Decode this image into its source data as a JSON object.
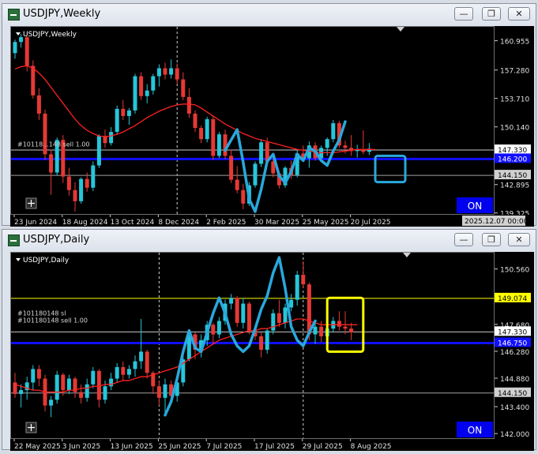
{
  "windows": [
    {
      "title": "USDJPY,Weekly",
      "chart_label": "USDJPY,Weekly",
      "order_label_a": "#10118...148 sell 1.00",
      "order_label_b": "",
      "on_label": "ON",
      "end_date_label": "2025.12.07 00:00",
      "buttons": [
        "minimize",
        "restore",
        "close"
      ]
    },
    {
      "title": "USDJPY,Daily",
      "chart_label": "USDJPY,Daily",
      "order_label_a": "#101180148 sl",
      "order_label_b": "#101180148 sell 1.00",
      "on_label": "ON",
      "end_date_label": "",
      "buttons": [
        "minimize",
        "restore",
        "close"
      ]
    }
  ],
  "chart_data": [
    {
      "type": "candlestick",
      "title": "USDJPY,Weekly",
      "ylim": [
        139.3,
        162.8
      ],
      "yticks": [
        160.955,
        157.28,
        153.71,
        150.14,
        146.57,
        144.15,
        142.895,
        139.325
      ],
      "y_tick_labels": [
        "160.955",
        "157.280",
        "153.710",
        "150.140",
        "",
        "144.150",
        "142.895",
        "139.325"
      ],
      "x_labels": [
        "23 Jun 2024",
        "18 Aug 2024",
        "13 Oct 2024",
        "8 Dec 2024",
        "2 Feb 2025",
        "30 Mar 2025",
        "25 May 2025",
        "20 Jul 2025"
      ],
      "x_label_index": [
        0,
        8,
        16,
        24,
        32,
        40,
        48,
        56
      ],
      "period_separators": [
        27
      ],
      "ma": [
        157.5,
        157.8,
        157.9,
        157.6,
        157.0,
        156.2,
        155.2,
        154.2,
        153.2,
        152.2,
        151.2,
        150.4,
        149.8,
        149.4,
        149.1,
        149.0,
        149.1,
        149.3,
        149.6,
        150.0,
        150.4,
        150.9,
        151.4,
        151.8,
        152.2,
        152.5,
        152.8,
        153.0,
        153.1,
        153.1,
        153.0,
        152.6,
        152.1,
        151.6,
        151.1,
        150.6,
        150.2,
        149.8,
        149.4,
        149.1,
        148.8,
        148.6,
        148.4,
        148.2,
        148.0,
        147.8,
        147.6,
        147.4,
        147.3,
        147.2,
        147.1,
        147.0,
        147.0,
        147.0,
        147.1,
        147.2,
        147.3,
        147.4,
        147.4,
        147.4,
        147.4
      ],
      "ohlc": [
        [
          159.5,
          161.2,
          158.8,
          160.9
        ],
        [
          160.9,
          161.9,
          160.2,
          161.5
        ],
        [
          161.5,
          161.7,
          157.2,
          157.9
        ],
        [
          157.9,
          158.6,
          153.8,
          154.2
        ],
        [
          154.2,
          155.1,
          151.1,
          151.9
        ],
        [
          151.9,
          152.4,
          146.1,
          146.8
        ],
        [
          146.8,
          147.4,
          141.7,
          144.5
        ],
        [
          144.5,
          148.9,
          144.1,
          148.6
        ],
        [
          148.6,
          149.2,
          143.2,
          144.0
        ],
        [
          144.0,
          145.1,
          141.6,
          142.3
        ],
        [
          142.3,
          143.3,
          139.6,
          140.9
        ],
        [
          140.9,
          143.9,
          140.6,
          143.7
        ],
        [
          143.7,
          144.5,
          142.1,
          142.6
        ],
        [
          142.6,
          145.9,
          142.2,
          145.4
        ],
        [
          145.4,
          149.3,
          145.1,
          149.1
        ],
        [
          149.1,
          149.9,
          147.6,
          148.2
        ],
        [
          148.2,
          150.2,
          147.9,
          149.6
        ],
        [
          149.6,
          152.9,
          149.3,
          152.5
        ],
        [
          152.5,
          153.6,
          151.1,
          151.6
        ],
        [
          151.6,
          152.6,
          150.5,
          152.3
        ],
        [
          152.3,
          156.9,
          151.9,
          156.6
        ],
        [
          156.6,
          157.1,
          153.6,
          154.1
        ],
        [
          154.1,
          155.6,
          153.2,
          154.8
        ],
        [
          154.8,
          156.9,
          154.3,
          156.6
        ],
        [
          156.6,
          158.1,
          155.3,
          157.6
        ],
        [
          157.6,
          158.3,
          156.2,
          156.8
        ],
        [
          156.8,
          158.7,
          156.3,
          157.6
        ],
        [
          157.6,
          158.2,
          155.6,
          156.2
        ],
        [
          156.2,
          157.1,
          153.6,
          154.0
        ],
        [
          154.0,
          155.1,
          151.4,
          151.9
        ],
        [
          151.9,
          152.3,
          149.6,
          150.1
        ],
        [
          150.1,
          150.4,
          148.2,
          148.7
        ],
        [
          148.7,
          151.5,
          148.3,
          151.2
        ],
        [
          151.2,
          151.7,
          146.1,
          146.6
        ],
        [
          146.6,
          149.6,
          146.3,
          149.3
        ],
        [
          149.3,
          149.9,
          146.2,
          146.6
        ],
        [
          146.6,
          147.4,
          143.2,
          143.6
        ],
        [
          143.6,
          145.3,
          141.9,
          142.3
        ],
        [
          142.3,
          143.1,
          139.9,
          140.6
        ],
        [
          140.6,
          143.3,
          140.3,
          142.9
        ],
        [
          142.9,
          145.9,
          142.6,
          145.6
        ],
        [
          145.6,
          148.7,
          145.2,
          148.3
        ],
        [
          148.3,
          148.9,
          145.6,
          145.9
        ],
        [
          145.9,
          146.6,
          143.9,
          144.4
        ],
        [
          144.4,
          144.7,
          142.5,
          142.9
        ],
        [
          142.9,
          145.3,
          142.6,
          145.1
        ],
        [
          145.1,
          146.0,
          143.7,
          144.2
        ],
        [
          144.2,
          147.3,
          143.9,
          146.9
        ],
        [
          146.9,
          147.9,
          145.9,
          146.3
        ],
        [
          146.3,
          148.4,
          145.1,
          147.9
        ],
        [
          147.9,
          148.3,
          146.0,
          146.3
        ],
        [
          146.3,
          147.9,
          145.9,
          147.6
        ],
        [
          147.6,
          148.9,
          146.6,
          148.7
        ],
        [
          148.7,
          151.1,
          148.3,
          150.7
        ],
        [
          150.7,
          151.0,
          147.6,
          147.9
        ],
        [
          147.9,
          148.5,
          146.9,
          147.6
        ],
        [
          147.6,
          149.2,
          146.6,
          147.2
        ],
        [
          147.2,
          148.0,
          146.4,
          147.4
        ],
        [
          147.4,
          149.8,
          146.8,
          147.1
        ],
        [
          147.1,
          148.2,
          146.7,
          147.5
        ]
      ],
      "current_price_line": 147.33,
      "hlines": [
        {
          "price": 146.2,
          "color": "#1010ff",
          "width": 3
        },
        {
          "price": 147.33,
          "color": "#c8c8c8",
          "width": 1
        },
        {
          "price": 144.15,
          "color": "#a0a0a0",
          "width": 1
        }
      ],
      "price_tags": [
        {
          "price": 147.33,
          "label": "147.330",
          "bg": "#ffffff",
          "fg": "#000000"
        },
        {
          "price": 146.2,
          "label": "146.200",
          "bg": "#1010ff",
          "fg": "#ffffff"
        },
        {
          "price": 144.15,
          "label": "144.150",
          "bg": "#d0d0d0",
          "fg": "#000000"
        }
      ],
      "annotation_color": "#29a8dc",
      "annotation_path": [
        [
          35,
          147.3
        ],
        [
          37,
          149.9
        ],
        [
          38,
          145.8
        ],
        [
          39,
          141.2
        ],
        [
          40,
          139.6
        ],
        [
          41,
          142.4
        ],
        [
          42,
          145.9
        ],
        [
          43,
          146.8
        ],
        [
          44,
          144.1
        ],
        [
          45,
          143.2
        ],
        [
          46,
          144.6
        ],
        [
          47,
          146.8
        ],
        [
          48,
          146.0
        ],
        [
          49,
          147.6
        ],
        [
          50,
          147.2
        ],
        [
          51,
          146.0
        ],
        [
          52,
          145.4
        ],
        [
          53,
          147.2
        ],
        [
          54,
          148.6
        ],
        [
          55,
          150.9
        ]
      ],
      "annotation_rect": [
        60,
        65,
        146.6,
        143.3
      ]
    },
    {
      "type": "candlestick",
      "title": "USDJPY,Daily",
      "ylim": [
        141.8,
        151.45
      ],
      "yticks": [
        150.56,
        149.074,
        147.68,
        147.33,
        146.28,
        144.88,
        144.15,
        143.4,
        142.0
      ],
      "y_tick_labels": [
        "150.560",
        "149.074",
        "147.680",
        "147.330",
        "146.280",
        "144.880",
        "144.150",
        "143.400",
        "142.000"
      ],
      "x_labels": [
        "22 May 2025",
        "3 Jun 2025",
        "13 Jun 2025",
        "25 Jun 2025",
        "7 Jul 2025",
        "17 Jul 2025",
        "29 Jul 2025",
        "8 Aug 2025"
      ],
      "x_label_index": [
        0,
        8,
        16,
        24,
        32,
        40,
        48,
        56
      ],
      "period_separators": [
        24,
        48
      ],
      "ma": [
        144.6,
        144.5,
        144.4,
        144.3,
        144.3,
        144.2,
        144.2,
        144.2,
        144.2,
        144.3,
        144.3,
        144.4,
        144.4,
        144.5,
        144.5,
        144.6,
        144.6,
        144.7,
        144.8,
        144.8,
        144.9,
        145.0,
        145.0,
        145.1,
        145.2,
        145.3,
        145.4,
        145.5,
        145.7,
        145.9,
        146.1,
        146.3,
        146.5,
        146.7,
        146.9,
        147.0,
        147.1,
        147.2,
        147.3,
        147.4,
        147.4,
        147.5,
        147.5,
        147.6,
        147.7,
        147.8,
        147.9,
        148.0,
        148.0,
        147.9,
        147.8,
        147.7,
        147.7,
        147.7,
        147.7,
        147.7,
        147.7,
        147.7
      ],
      "ohlc": [
        [
          144.7,
          145.2,
          143.9,
          144.1
        ],
        [
          144.1,
          144.6,
          143.4,
          144.3
        ],
        [
          144.3,
          145.0,
          143.8,
          144.7
        ],
        [
          144.7,
          145.6,
          144.3,
          145.4
        ],
        [
          145.4,
          145.6,
          144.5,
          144.9
        ],
        [
          144.9,
          145.1,
          143.2,
          143.5
        ],
        [
          143.5,
          144.0,
          142.9,
          143.8
        ],
        [
          143.8,
          145.3,
          143.6,
          145.1
        ],
        [
          145.1,
          145.2,
          144.0,
          144.3
        ],
        [
          144.3,
          145.1,
          144.1,
          144.9
        ],
        [
          144.9,
          145.0,
          143.9,
          144.2
        ],
        [
          144.2,
          144.6,
          143.6,
          143.9
        ],
        [
          143.9,
          144.9,
          143.7,
          144.6
        ],
        [
          144.6,
          145.5,
          144.4,
          145.3
        ],
        [
          145.3,
          145.4,
          143.4,
          143.8
        ],
        [
          143.8,
          144.8,
          143.6,
          144.5
        ],
        [
          144.5,
          145.2,
          144.3,
          144.9
        ],
        [
          144.9,
          145.7,
          144.7,
          145.5
        ],
        [
          145.5,
          145.8,
          144.8,
          145.1
        ],
        [
          145.1,
          145.6,
          144.9,
          145.4
        ],
        [
          145.4,
          146.1,
          145.0,
          145.8
        ],
        [
          145.8,
          148.0,
          145.4,
          146.3
        ],
        [
          146.3,
          146.4,
          144.9,
          145.2
        ],
        [
          145.2,
          145.3,
          144.1,
          144.5
        ],
        [
          144.5,
          144.8,
          143.5,
          143.9
        ],
        [
          143.9,
          144.9,
          143.0,
          144.6
        ],
        [
          144.6,
          144.8,
          143.6,
          144.0
        ],
        [
          144.0,
          144.9,
          143.7,
          144.7
        ],
        [
          144.7,
          146.2,
          144.5,
          145.9
        ],
        [
          145.9,
          147.4,
          145.8,
          147.2
        ],
        [
          147.2,
          147.3,
          145.9,
          146.4
        ],
        [
          146.4,
          147.2,
          146.0,
          146.9
        ],
        [
          146.9,
          147.9,
          146.6,
          147.7
        ],
        [
          147.7,
          147.8,
          146.7,
          147.2
        ],
        [
          147.2,
          148.1,
          147.0,
          147.9
        ],
        [
          147.9,
          149.0,
          147.7,
          148.8
        ],
        [
          148.8,
          149.3,
          148.5,
          149.1
        ],
        [
          149.1,
          149.2,
          147.6,
          147.8
        ],
        [
          147.8,
          149.1,
          147.5,
          148.8
        ],
        [
          148.8,
          148.9,
          147.2,
          147.4
        ],
        [
          147.4,
          147.7,
          146.9,
          147.1
        ],
        [
          147.1,
          147.3,
          146.0,
          146.4
        ],
        [
          146.4,
          147.5,
          146.2,
          147.4
        ],
        [
          147.4,
          148.5,
          147.2,
          148.3
        ],
        [
          148.3,
          149.0,
          147.6,
          147.8
        ],
        [
          147.8,
          148.8,
          147.5,
          148.6
        ],
        [
          148.6,
          149.3,
          148.4,
          149.0
        ],
        [
          149.0,
          150.5,
          148.7,
          150.3
        ],
        [
          150.3,
          151.0,
          149.6,
          149.8
        ],
        [
          149.8,
          149.9,
          146.9,
          147.2
        ],
        [
          147.2,
          147.9,
          146.7,
          147.6
        ],
        [
          147.6,
          147.9,
          146.8,
          147.1
        ],
        [
          147.1,
          147.7,
          146.9,
          147.5
        ],
        [
          147.5,
          148.1,
          147.3,
          147.9
        ],
        [
          147.9,
          148.4,
          147.4,
          147.6
        ],
        [
          147.6,
          148.4,
          147.2,
          147.5
        ],
        [
          147.5,
          147.8,
          146.9,
          147.3
        ]
      ],
      "current_price_line": 147.33,
      "hlines": [
        {
          "price": 149.074,
          "color": "#ffff00",
          "width": 1
        },
        {
          "price": 147.33,
          "color": "#c8c8c8",
          "width": 1
        },
        {
          "price": 146.75,
          "color": "#1010ff",
          "width": 3
        },
        {
          "price": 144.15,
          "color": "#a0a0a0",
          "width": 1
        }
      ],
      "price_tags": [
        {
          "price": 149.074,
          "label": "149.074",
          "bg": "#ffff00",
          "fg": "#000000"
        },
        {
          "price": 147.33,
          "label": "147.330",
          "bg": "#ffffff",
          "fg": "#000000"
        },
        {
          "price": 146.75,
          "label": "146.750",
          "bg": "#1010ff",
          "fg": "#ffffff"
        },
        {
          "price": 144.15,
          "label": "144.150",
          "bg": "#d0d0d0",
          "fg": "#000000"
        }
      ],
      "annotation_color": "#29a8dc",
      "annotation_path": [
        [
          25,
          143.0
        ],
        [
          26,
          143.7
        ],
        [
          27,
          144.9
        ],
        [
          28,
          146.3
        ],
        [
          29,
          147.4
        ],
        [
          30,
          146.5
        ],
        [
          31,
          146.3
        ],
        [
          32,
          147.3
        ],
        [
          33,
          148.3
        ],
        [
          34,
          149.1
        ],
        [
          35,
          148.3
        ],
        [
          36,
          147.2
        ],
        [
          37,
          146.6
        ],
        [
          38,
          146.3
        ],
        [
          39,
          146.6
        ],
        [
          40,
          147.5
        ],
        [
          41,
          148.5
        ],
        [
          42,
          149.2
        ],
        [
          43,
          150.4
        ],
        [
          44,
          151.2
        ],
        [
          45,
          149.6
        ],
        [
          46,
          147.6
        ],
        [
          47,
          146.9
        ],
        [
          48,
          146.6
        ],
        [
          49,
          147.3
        ],
        [
          50,
          147.9
        ]
      ],
      "annotation_rect": [
        52,
        58,
        149.1,
        146.3
      ]
    }
  ]
}
